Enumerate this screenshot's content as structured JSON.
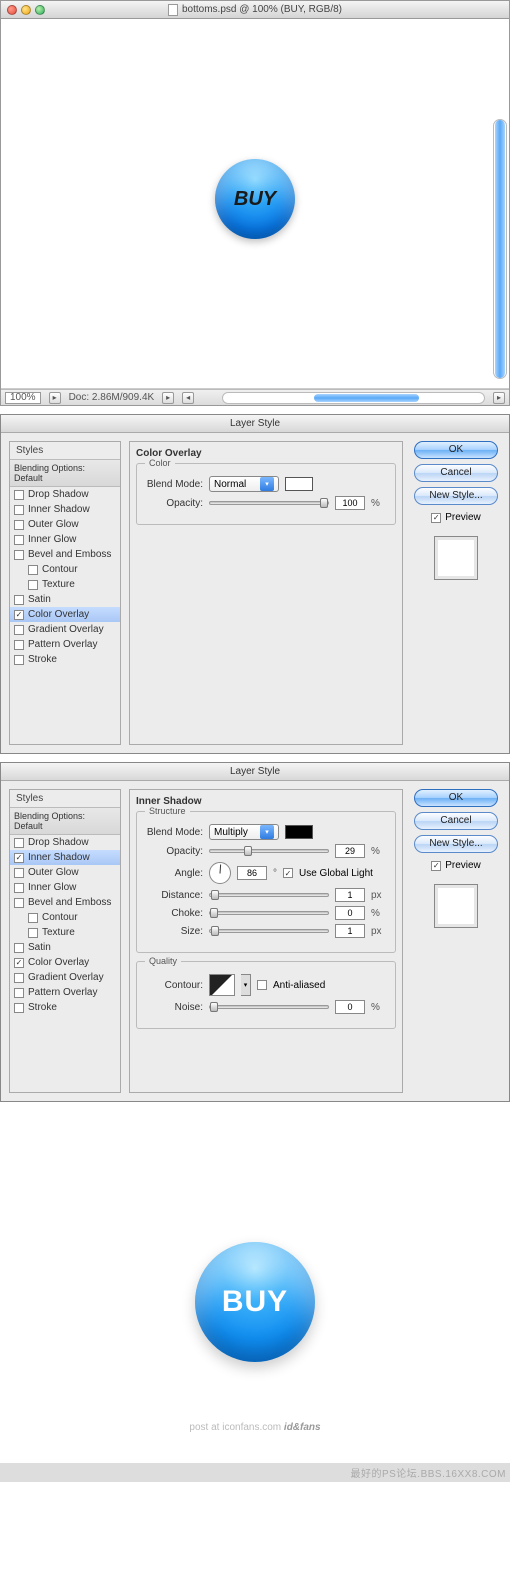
{
  "doc": {
    "title": "bottoms.psd @ 100% (BUY, RGB/8)",
    "zoom": "100%",
    "info": "Doc: 2.86M/909.4K",
    "buy_text": "BUY"
  },
  "dlg1": {
    "title": "Layer Style",
    "section_title": "Color Overlay",
    "group_color": "Color",
    "blend_mode_label": "Blend Mode:",
    "blend_mode_value": "Normal",
    "opacity_label": "Opacity:",
    "opacity_value": "100",
    "opacity_unit": "%"
  },
  "dlg2": {
    "title": "Layer Style",
    "section_title": "Inner Shadow",
    "group_structure": "Structure",
    "group_quality": "Quality",
    "blend_mode_label": "Blend Mode:",
    "blend_mode_value": "Multiply",
    "opacity_label": "Opacity:",
    "opacity_value": "29",
    "opacity_unit": "%",
    "angle_label": "Angle:",
    "angle_value": "86",
    "angle_unit": "°",
    "global_light_label": "Use Global Light",
    "distance_label": "Distance:",
    "distance_value": "1",
    "distance_unit": "px",
    "choke_label": "Choke:",
    "choke_value": "0",
    "choke_unit": "%",
    "size_label": "Size:",
    "size_value": "1",
    "size_unit": "px",
    "contour_label": "Contour:",
    "anti_alias_label": "Anti-aliased",
    "noise_label": "Noise:",
    "noise_value": "0",
    "noise_unit": "%"
  },
  "styles": {
    "head": "Styles",
    "blending": "Blending Options: Default",
    "items": [
      {
        "label": "Drop Shadow",
        "checked": false
      },
      {
        "label": "Inner Shadow",
        "checked": false
      },
      {
        "label": "Outer Glow",
        "checked": false
      },
      {
        "label": "Inner Glow",
        "checked": false
      },
      {
        "label": "Bevel and Emboss",
        "checked": false
      },
      {
        "label": "Contour",
        "checked": false,
        "sub": true
      },
      {
        "label": "Texture",
        "checked": false,
        "sub": true
      },
      {
        "label": "Satin",
        "checked": false
      },
      {
        "label": "Color Overlay",
        "checked": true
      },
      {
        "label": "Gradient Overlay",
        "checked": false
      },
      {
        "label": "Pattern Overlay",
        "checked": false
      },
      {
        "label": "Stroke",
        "checked": false
      }
    ]
  },
  "styles2": {
    "items": [
      {
        "label": "Drop Shadow",
        "checked": false
      },
      {
        "label": "Inner Shadow",
        "checked": true
      },
      {
        "label": "Outer Glow",
        "checked": false
      },
      {
        "label": "Inner Glow",
        "checked": false
      },
      {
        "label": "Bevel and Emboss",
        "checked": false
      },
      {
        "label": "Contour",
        "checked": false,
        "sub": true
      },
      {
        "label": "Texture",
        "checked": false,
        "sub": true
      },
      {
        "label": "Satin",
        "checked": false
      },
      {
        "label": "Color Overlay",
        "checked": true
      },
      {
        "label": "Gradient Overlay",
        "checked": false
      },
      {
        "label": "Pattern Overlay",
        "checked": false
      },
      {
        "label": "Stroke",
        "checked": false
      }
    ]
  },
  "buttons": {
    "ok": "OK",
    "cancel": "Cancel",
    "new_style": "New Style...",
    "preview": "Preview"
  },
  "final": {
    "buy_text": "BUY"
  },
  "footer": {
    "prefix": "post at ",
    "site": "iconfans",
    "suffix": ".com",
    "brand": " id&fans"
  },
  "watermark": "最好的PS论坛.BBS.16XX8.COM"
}
